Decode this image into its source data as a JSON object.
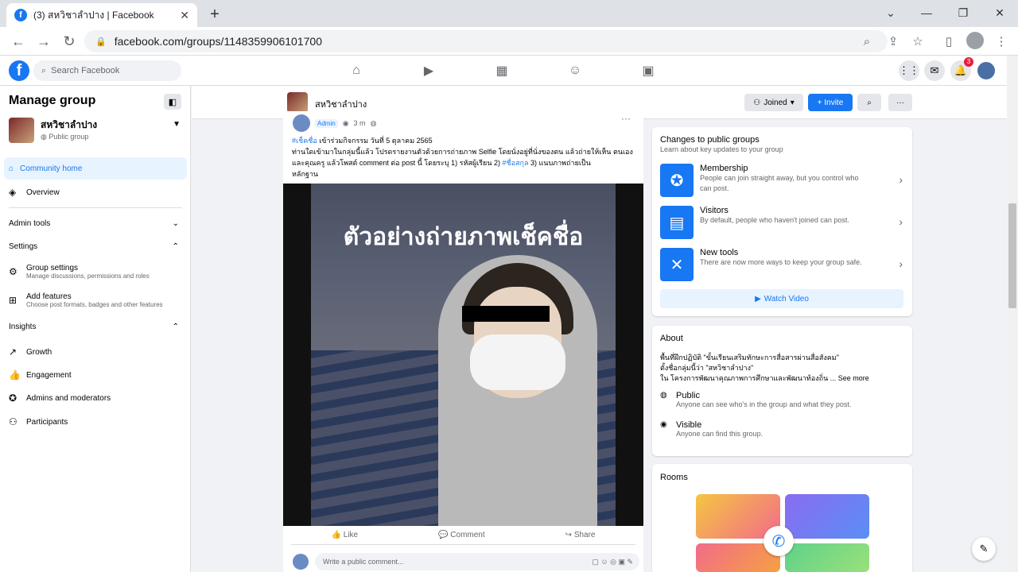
{
  "browser": {
    "tab_title": "(3) สหวิชาลำปาง | Facebook",
    "url": "facebook.com/groups/1148359906101700",
    "icons": [
      "back-icon",
      "forward-icon",
      "reload-icon",
      "zoom-icon",
      "share-icon",
      "star-icon",
      "sidebar-icon",
      "menu-icon"
    ]
  },
  "header": {
    "logo": "f",
    "search_placeholder": "Search Facebook",
    "notifications_count": "3"
  },
  "sidebar": {
    "title": "Manage group",
    "group_name": "สหวิชาลำปาง",
    "group_privacy": "Public group",
    "community_home": "Community home",
    "overview": "Overview",
    "admin_tools": "Admin tools",
    "settings": "Settings",
    "group_settings": "Group settings",
    "group_settings_sub": "Manage discussions, permissions and roles",
    "add_features": "Add features",
    "add_features_sub": "Choose post formats, badges and other features",
    "insights": "Insights",
    "growth": "Growth",
    "engagement": "Engagement",
    "admins": "Admins and moderators",
    "participants": "Participants"
  },
  "groupbar": {
    "name": "สหวิชาลำปาง",
    "joined": "Joined",
    "invite": "+ Invite"
  },
  "post": {
    "badge": "Admin",
    "time": "3 m",
    "tag1": "#เช็คชื่อ",
    "line1": " เข้าร่วมกิจกรรม วันที่ 5 ตุลาคม 2565",
    "line2a": "ท่านใดเข้ามาในกลุ่มนี้แล้ว โปรดรายงานตัวด้วยการถ่ายภาพ Selfie โดยนั่งอยู่ที่นั่งของตน แล้วถ่ายให้เห็น",
    "line2b": "ตนเองและคุณครู แล้วโพสต์ comment ต่อ post นี้ โดยระบุ 1) รหัสผู้เรียน 2) ",
    "tag2": "#ชื่อสกุล",
    "line2c": " 3) แนบภาพถ่ายเป็น",
    "line3": "หลักฐาน",
    "image_caption": "ตัวอย่างถ่ายภาพเช็คชื่อ",
    "like": "Like",
    "comment": "Comment",
    "share": "Share",
    "comment_placeholder": "Write a public comment..."
  },
  "changes": {
    "title": "Changes to public groups",
    "subtitle": "Learn about key updates to your group",
    "items": [
      {
        "title": "Membership",
        "desc1": "People can join straight away, but you control who",
        "desc2": "can post."
      },
      {
        "title": "Visitors",
        "desc1": "By default, people who haven't joined can post.",
        "desc2": ""
      },
      {
        "title": "New tools",
        "desc1": "There are now more ways to keep your group safe.",
        "desc2": ""
      }
    ],
    "watch": "Watch Video"
  },
  "about": {
    "title": "About",
    "line1": "พื้นที่ฝึกปฏิบัติ \"ขั้นเรียนเสริมทักษะการสื่อสารผ่านสื่อสังคม\"",
    "line2": "ตั้งชื่อกลุ่มนี้ว่า \"สหวิชาลำปาง\"",
    "line3": "ใน โครงการพัฒนาคุณภาพการศึกษาและพัฒนาท้องถิ่น ... See more",
    "public_title": "Public",
    "public_desc": "Anyone can see who's in the group and what they post.",
    "visible_title": "Visible",
    "visible_desc": "Anyone can find this group."
  },
  "rooms": {
    "title": "Rooms"
  }
}
